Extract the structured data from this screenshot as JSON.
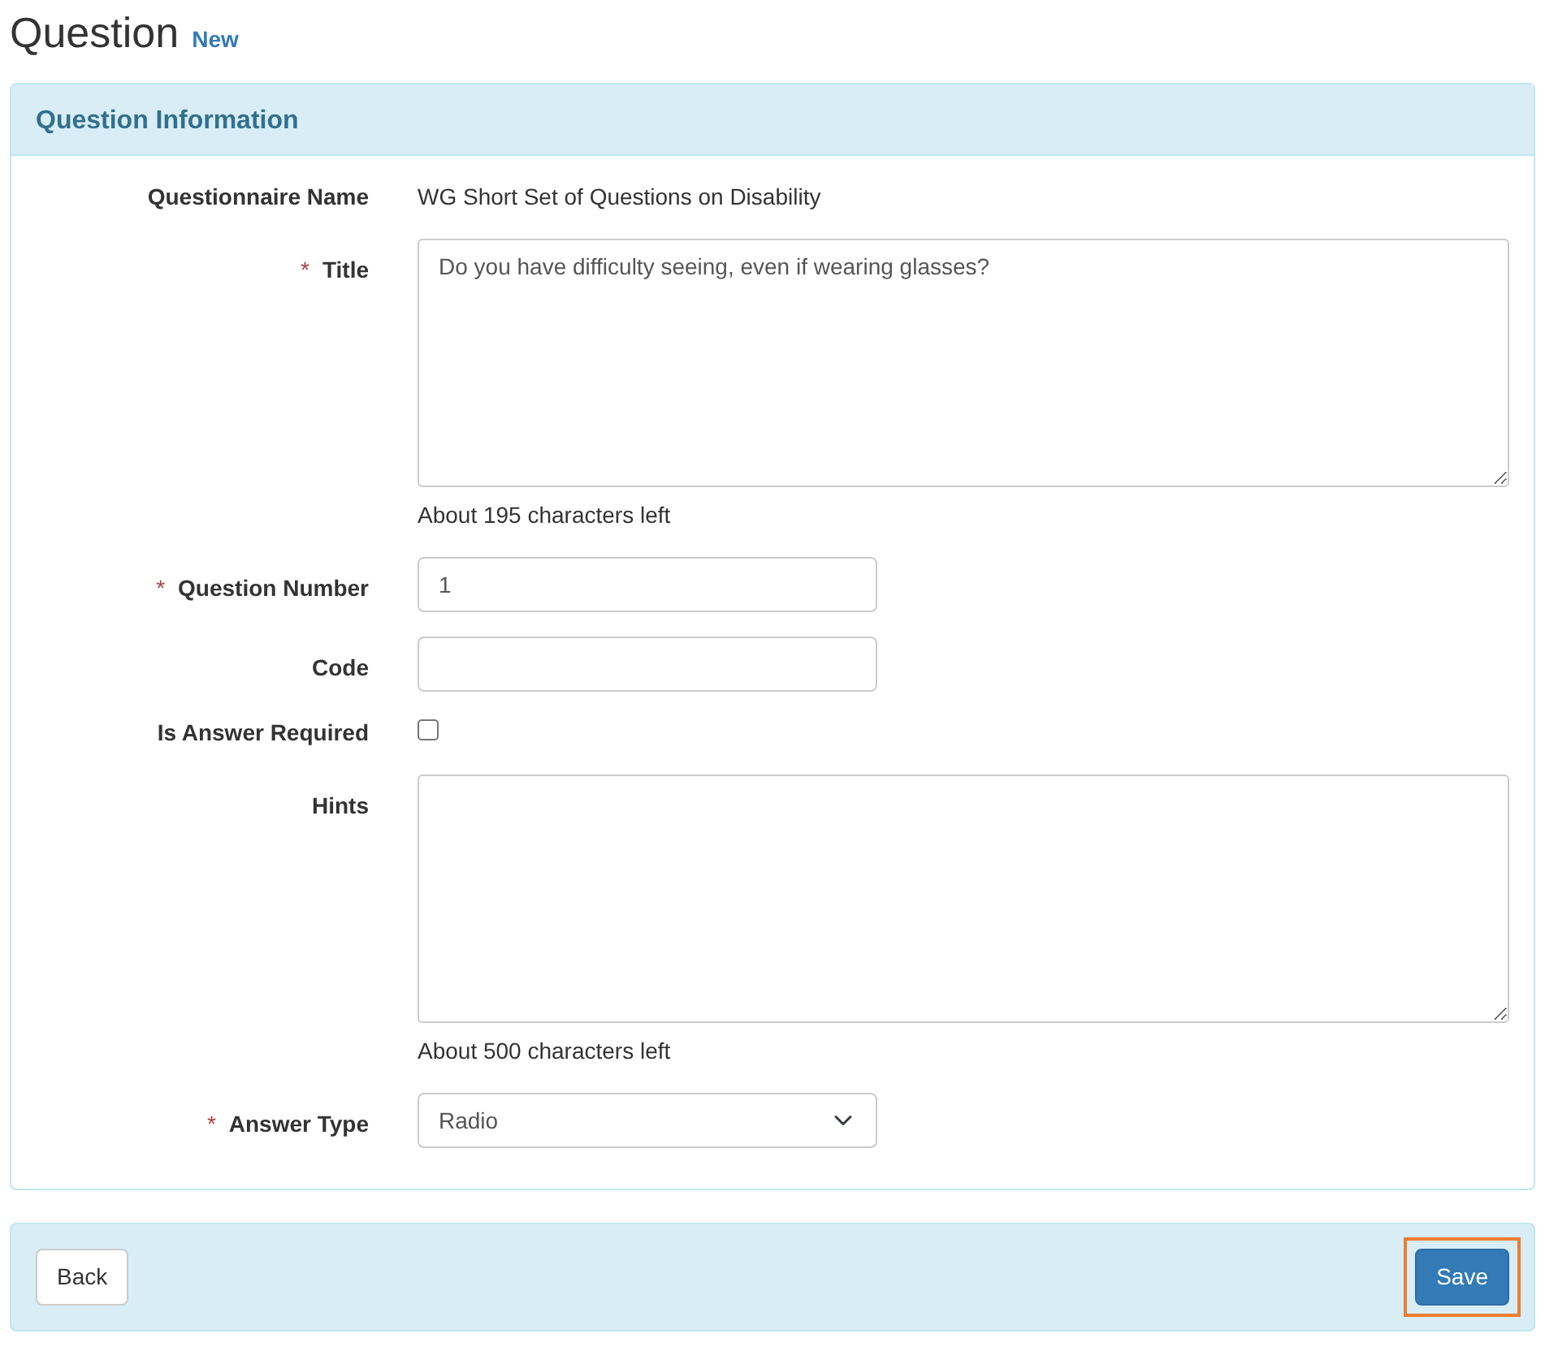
{
  "page": {
    "title": "Question",
    "subtitle": "New"
  },
  "panel": {
    "title": "Question Information",
    "fields": [
      {
        "kind": "static",
        "label": "Questionnaire Name",
        "value": "WG Short Set of Questions on Disability"
      },
      {
        "kind": "textarea",
        "mark": "*",
        "label": "Title",
        "value": "Do you have difficulty seeing, even if wearing glasses?",
        "help": "About 195 characters left"
      },
      {
        "kind": "input",
        "mark": "*",
        "label": "Question Number",
        "value": "1"
      },
      {
        "kind": "input",
        "label": "Code"
      },
      {
        "kind": "checkbox",
        "label": "Is Answer Required",
        "checked": false
      },
      {
        "kind": "textarea",
        "label": "Hints",
        "help": "About 500 characters left"
      },
      {
        "kind": "select",
        "mark": "*",
        "label": "Answer Type",
        "value": "Radio"
      }
    ]
  },
  "footer": {
    "buttons": [
      {
        "kind": "default",
        "label": "Back",
        "highlighted": false
      },
      {
        "kind": "primary",
        "label": "Save",
        "highlighted": true
      }
    ]
  }
}
